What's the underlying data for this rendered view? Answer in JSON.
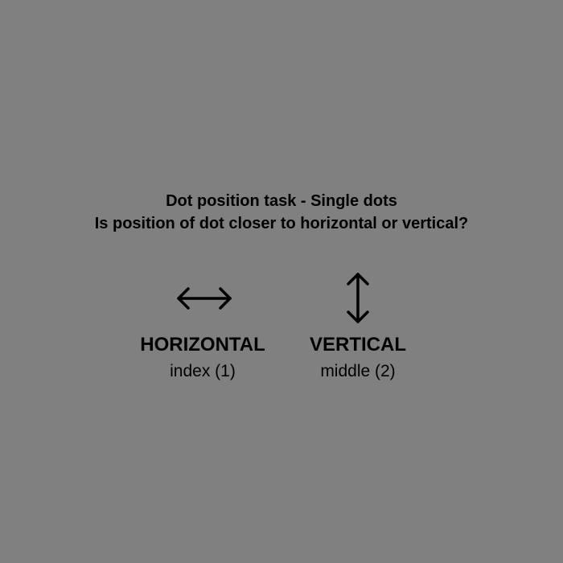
{
  "instructions": {
    "title": "Dot position task - Single dots",
    "question": "Is position of dot closer to horizontal or vertical?"
  },
  "options": {
    "horizontal": {
      "icon": "left-right-arrow-icon",
      "label": "HORIZONTAL",
      "key": "index (1)"
    },
    "vertical": {
      "icon": "up-down-arrow-icon",
      "label": "VERTICAL",
      "key": "middle (2)"
    }
  },
  "colors": {
    "background": "#808080",
    "text": "#000000"
  }
}
